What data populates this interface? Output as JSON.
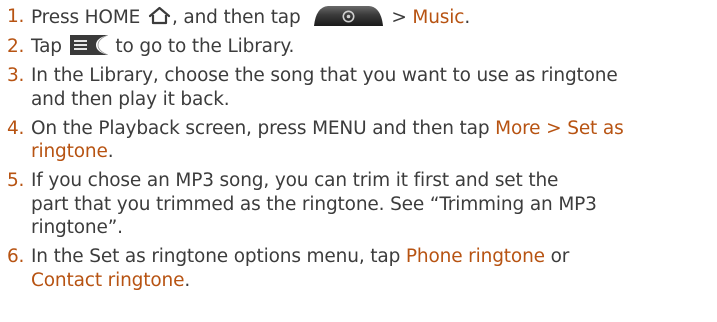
{
  "steps": [
    {
      "number": "1.",
      "text_a": "Press HOME",
      "text_b": ", and then tap",
      "text_c": "> ",
      "emphasis": "Music",
      "text_d": ".",
      "icons": [
        "home-icon",
        "all-apps-icon"
      ]
    },
    {
      "number": "2.",
      "text_a": "Tap",
      "text_b": "to go to the Library.",
      "icons": [
        "library-icon"
      ]
    },
    {
      "number": "3.",
      "line1": "In the Library, choose the song that you want to use as ringtone",
      "line2": "and then play it back."
    },
    {
      "number": "4.",
      "text_a": "On the Playback screen, press MENU and then tap ",
      "emphasis": "More > Set as ringtone",
      "text_b": "."
    },
    {
      "number": "5.",
      "line1": "If you chose an MP3 song, you can trim it first and set the",
      "line2": "part that you trimmed as the ringtone. See “Trimming an MP3",
      "line3": "ringtone”."
    },
    {
      "number": "6.",
      "text_a": "In the Set as ringtone options menu, tap ",
      "emphasis_a": "Phone ringtone",
      "text_b": " or",
      "emphasis_b": "Contact ringtone",
      "text_c": "."
    }
  ],
  "colors": {
    "body_text": "#3c3c3c",
    "accent": "#b75312"
  }
}
